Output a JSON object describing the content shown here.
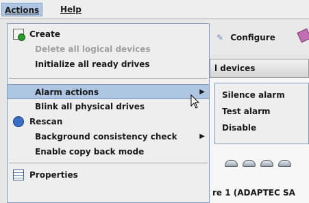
{
  "menubar": {
    "actions": "Actions",
    "help": "Help"
  },
  "actions_menu": {
    "items": [
      {
        "label": "Create",
        "icon": "create-icon",
        "enabled": true
      },
      {
        "label": "Delete all logical devices",
        "enabled": false
      },
      {
        "label": "Initialize all ready drives",
        "enabled": true
      },
      {
        "label": "Alarm actions",
        "enabled": true,
        "submenu": true,
        "selected": true
      },
      {
        "label": "Blink all physical drives",
        "enabled": true
      },
      {
        "label": "Rescan",
        "icon": "rescan-icon",
        "enabled": true
      },
      {
        "label": "Background consistency check",
        "enabled": true,
        "submenu": true
      },
      {
        "label": "Enable copy back mode",
        "enabled": true
      },
      {
        "label": "Properties",
        "icon": "properties-icon",
        "enabled": true
      }
    ]
  },
  "alarm_submenu": {
    "items": [
      "Silence alarm",
      "Test alarm",
      "Disable"
    ]
  },
  "background": {
    "toolbar_configure": "Configure",
    "tab_header": "l devices",
    "enclosure_label": "re 1 (ADAPTEC SA"
  },
  "colors": {
    "selection": "#aec6e2",
    "menu_border": "#7f9cbf",
    "disabled_text": "#a0a0a0"
  }
}
